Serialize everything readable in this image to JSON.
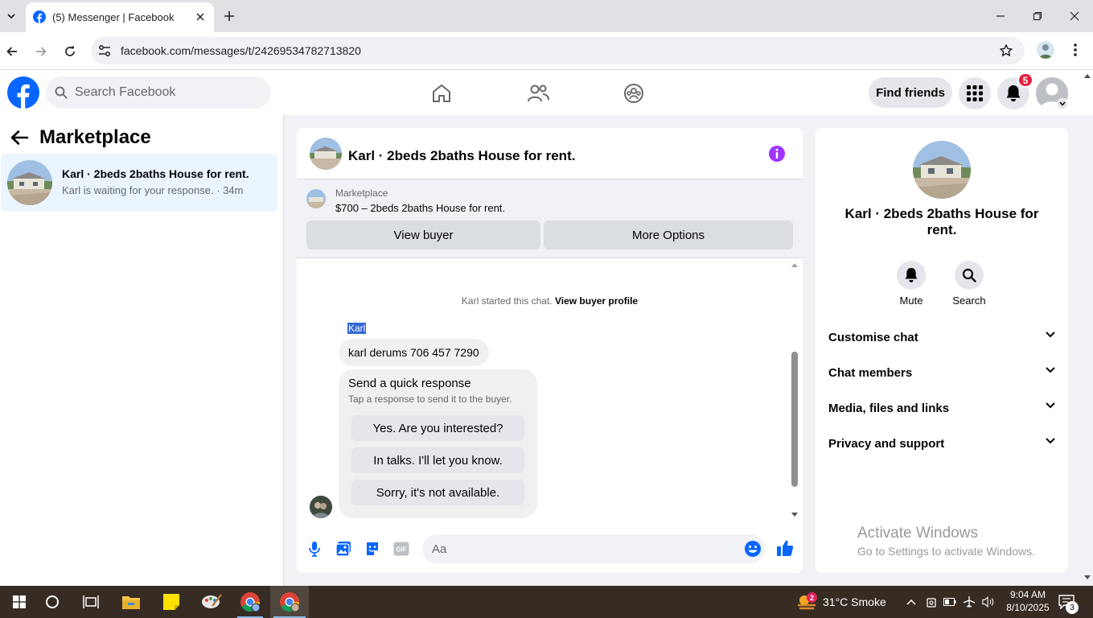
{
  "browser": {
    "tab_title": "(5) Messenger | Facebook",
    "url": "facebook.com/messages/t/24269534782713820"
  },
  "header": {
    "search_placeholder": "Search Facebook",
    "find_friends_label": "Find friends",
    "notification_count": "5",
    "brand_color": "#0866ff"
  },
  "left_panel": {
    "title": "Marketplace",
    "conversation": {
      "name": "Karl · 2beds 2baths House for rent.",
      "preview": "Karl is waiting for your response. · 34m"
    }
  },
  "chat": {
    "title": "Karl · 2beds 2baths House for rent.",
    "marketplace_label": "Marketplace",
    "listing": "$700 – 2beds 2baths House for rent.",
    "view_buyer_label": "View buyer",
    "more_options_label": "More Options",
    "started_text": "Karl started this chat.",
    "view_profile_link": "View buyer profile",
    "sender_name": "Karl",
    "message": "karl derums 706 457 7290",
    "quick_response": {
      "title": "Send a quick response",
      "subtitle": "Tap a response to send it to the buyer.",
      "options": [
        "Yes. Are you interested?",
        "In talks. I'll let you know.",
        "Sorry, it's not available."
      ]
    },
    "composer_placeholder": "Aa",
    "accent_color": "#a033ff"
  },
  "right_panel": {
    "name": "Karl · 2beds 2baths House for rent.",
    "mute_label": "Mute",
    "search_label": "Search",
    "sections": [
      "Customise chat",
      "Chat members",
      "Media, files and links",
      "Privacy and support"
    ]
  },
  "watermark": {
    "title": "Activate Windows",
    "subtitle": "Go to Settings to activate Windows."
  },
  "taskbar": {
    "weather_badge": "2",
    "weather": "31°C  Smoke",
    "time": "9:04 AM",
    "date": "8/10/2025",
    "notification_count": "3"
  }
}
